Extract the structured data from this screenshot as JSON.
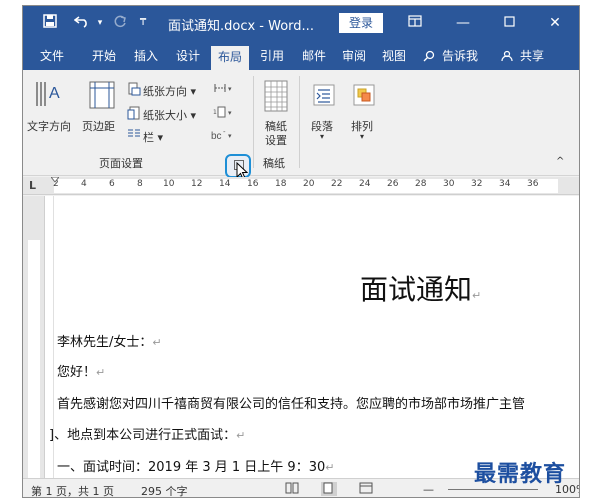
{
  "titlebar": {
    "document_title": "面试通知.docx - Word...",
    "login_label": "登录",
    "icons": [
      "save-icon",
      "undo-icon",
      "redo-icon",
      "customize-icon"
    ]
  },
  "tabs": [
    {
      "label": "文件"
    },
    {
      "label": "开始"
    },
    {
      "label": "插入"
    },
    {
      "label": "设计"
    },
    {
      "label": "布局",
      "active": true
    },
    {
      "label": "引用"
    },
    {
      "label": "邮件"
    },
    {
      "label": "审阅"
    },
    {
      "label": "视图"
    },
    {
      "label": "告诉我"
    },
    {
      "label": "共享"
    }
  ],
  "ribbon": {
    "text_direction": "文字方向",
    "margins": "页边距",
    "orientation": "纸张方向",
    "size": "纸张大小",
    "columns": "栏",
    "stationery_line1": "稿纸",
    "stationery_line2": "设置",
    "paragraph": "段落",
    "arrange": "排列",
    "group_page_setup": "页面设置",
    "group_stationery": "稿纸"
  },
  "ruler": {
    "numbers": [
      "2",
      "4",
      "6",
      "8",
      "10",
      "12",
      "14",
      "16",
      "18",
      "20",
      "22",
      "24",
      "26",
      "28",
      "30",
      "32",
      "34",
      "36"
    ],
    "corner_label": "L"
  },
  "document": {
    "title": "面试通知",
    "lines": [
      "李林先生/女士：",
      "您好！",
      "首先感谢您对四川千禧商贸有限公司的信任和支持。您应聘的市场部市场推广主管",
      "]、地点到本公司进行正式面试：",
      "一、面试时间：2019 年 3 月 1 日上午 9：30"
    ],
    "paragraph_mark": "↵"
  },
  "status": {
    "page": "第 1 页，共 1 页",
    "words": "295 个字",
    "zoom": "100%"
  },
  "watermark": "最需教育",
  "colors": {
    "word_blue": "#2b579a",
    "highlight": "#1e8fd6"
  }
}
